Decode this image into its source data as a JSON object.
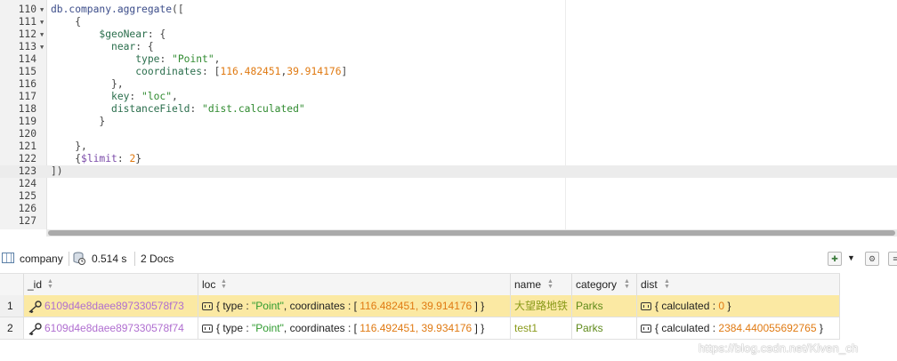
{
  "editor": {
    "lines": [
      {
        "num": "110",
        "fold": "▼",
        "tokens": [
          {
            "t": "db.company.aggregate",
            "c": "t-plain"
          },
          {
            "t": "([",
            "c": "t-punc"
          }
        ]
      },
      {
        "num": "111",
        "fold": "▼",
        "tokens": [
          {
            "t": "    {",
            "c": "t-punc"
          }
        ]
      },
      {
        "num": "112",
        "fold": "▼",
        "tokens": [
          {
            "t": "        ",
            "c": "t-punc"
          },
          {
            "t": "$geoNear",
            "c": "t-key"
          },
          {
            "t": ": {",
            "c": "t-punc"
          }
        ]
      },
      {
        "num": "113",
        "fold": "▼",
        "tokens": [
          {
            "t": "          ",
            "c": "t-punc"
          },
          {
            "t": "near",
            "c": "t-key"
          },
          {
            "t": ": {",
            "c": "t-punc"
          }
        ]
      },
      {
        "num": "114",
        "fold": "",
        "tokens": [
          {
            "t": "              ",
            "c": "t-punc"
          },
          {
            "t": "type",
            "c": "t-key"
          },
          {
            "t": ": ",
            "c": "t-punc"
          },
          {
            "t": "\"Point\"",
            "c": "t-str"
          },
          {
            "t": ",",
            "c": "t-punc"
          }
        ]
      },
      {
        "num": "115",
        "fold": "",
        "tokens": [
          {
            "t": "              ",
            "c": "t-punc"
          },
          {
            "t": "coordinates",
            "c": "t-key"
          },
          {
            "t": ": [",
            "c": "t-punc"
          },
          {
            "t": "116.482451",
            "c": "t-num"
          },
          {
            "t": ",",
            "c": "t-punc"
          },
          {
            "t": "39.914176",
            "c": "t-num"
          },
          {
            "t": "]",
            "c": "t-punc"
          }
        ]
      },
      {
        "num": "116",
        "fold": "",
        "tokens": [
          {
            "t": "          },",
            "c": "t-punc"
          }
        ]
      },
      {
        "num": "117",
        "fold": "",
        "tokens": [
          {
            "t": "          ",
            "c": "t-punc"
          },
          {
            "t": "key",
            "c": "t-key"
          },
          {
            "t": ": ",
            "c": "t-punc"
          },
          {
            "t": "\"loc\"",
            "c": "t-str"
          },
          {
            "t": ",",
            "c": "t-punc"
          }
        ]
      },
      {
        "num": "118",
        "fold": "",
        "tokens": [
          {
            "t": "          ",
            "c": "t-punc"
          },
          {
            "t": "distanceField",
            "c": "t-key"
          },
          {
            "t": ": ",
            "c": "t-punc"
          },
          {
            "t": "\"dist.calculated\"",
            "c": "t-str"
          }
        ]
      },
      {
        "num": "119",
        "fold": "",
        "tokens": [
          {
            "t": "        }",
            "c": "t-punc"
          }
        ]
      },
      {
        "num": "120",
        "fold": "",
        "tokens": []
      },
      {
        "num": "121",
        "fold": "",
        "tokens": [
          {
            "t": "    },",
            "c": "t-punc"
          }
        ]
      },
      {
        "num": "122",
        "fold": "",
        "tokens": [
          {
            "t": "    {",
            "c": "t-punc"
          },
          {
            "t": "$limit",
            "c": "t-op"
          },
          {
            "t": ": ",
            "c": "t-punc"
          },
          {
            "t": "2",
            "c": "t-num"
          },
          {
            "t": "}",
            "c": "t-punc"
          }
        ]
      },
      {
        "num": "123",
        "fold": "",
        "active": true,
        "tokens": [
          {
            "t": "])",
            "c": "t-punc"
          }
        ]
      },
      {
        "num": "124",
        "fold": "",
        "tokens": []
      },
      {
        "num": "125",
        "fold": "",
        "tokens": []
      },
      {
        "num": "126",
        "fold": "",
        "tokens": []
      },
      {
        "num": "127",
        "fold": "",
        "tokens": []
      }
    ]
  },
  "status": {
    "collection": "company",
    "time": "0.514 s",
    "docs": "2 Docs"
  },
  "grid": {
    "columns": [
      "_id",
      "loc",
      "name",
      "category",
      "dist"
    ],
    "rows": [
      {
        "num": "1",
        "id": "6109d4e8daee897330578f73",
        "loc_prefix": "{ type : ",
        "loc_type": "\"Point\"",
        "loc_mid": ", coordinates : [ ",
        "loc_x": "116.482451",
        "loc_comma": ", ",
        "loc_y": "39.914176",
        "loc_suffix": " ] }",
        "name": "大望路地铁",
        "category": "Parks",
        "dist_prefix": "{ calculated : ",
        "dist_value": "0",
        "dist_suffix": " }"
      },
      {
        "num": "2",
        "id": "6109d4e8daee897330578f74",
        "loc_prefix": "{ type : ",
        "loc_type": "\"Point\"",
        "loc_mid": ", coordinates : [ ",
        "loc_x": "116.492451",
        "loc_comma": ", ",
        "loc_y": "39.934176",
        "loc_suffix": " ] }",
        "name": "test1",
        "category": "Parks",
        "dist_prefix": "{ calculated : ",
        "dist_value": "2384.440055692765",
        "dist_suffix": " }"
      }
    ]
  },
  "watermark": "https://blog.csdn.net/Kiven_ch",
  "icons": {
    "table": "table-icon",
    "timer": "timer-icon",
    "export": "export-icon",
    "dropdown": "chevron-down-icon",
    "settings": "settings-icon"
  }
}
